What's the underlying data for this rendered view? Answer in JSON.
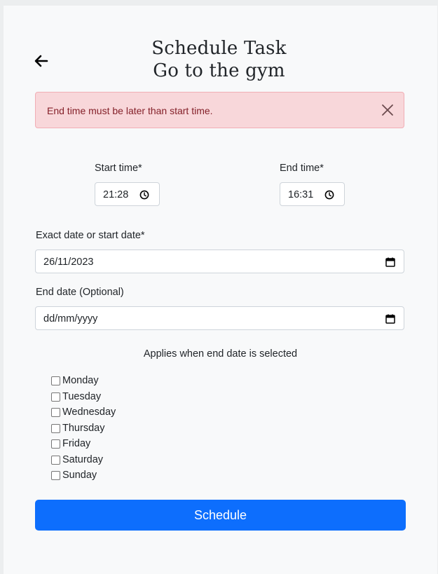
{
  "header": {
    "title": "Schedule Task",
    "task_name": "Go to the gym"
  },
  "alert": {
    "message": "End time must be later than start time."
  },
  "form": {
    "start_time_label": "Start time*",
    "start_time_value": "21:28",
    "end_time_label": "End time*",
    "end_time_value": "16:31",
    "start_date_label": "Exact date or start date*",
    "start_date_value": "26/11/2023",
    "end_date_label": "End date (Optional)",
    "end_date_placeholder": "dd/mm/yyyy",
    "days_hint": "Applies when end date is selected",
    "days": [
      "Monday",
      "Tuesday",
      "Wednesday",
      "Thursday",
      "Friday",
      "Saturday",
      "Sunday"
    ],
    "submit_label": "Schedule"
  },
  "colors": {
    "accent": "#0d6efd",
    "alert_bg": "#f8d7da",
    "alert_text": "#842029"
  }
}
